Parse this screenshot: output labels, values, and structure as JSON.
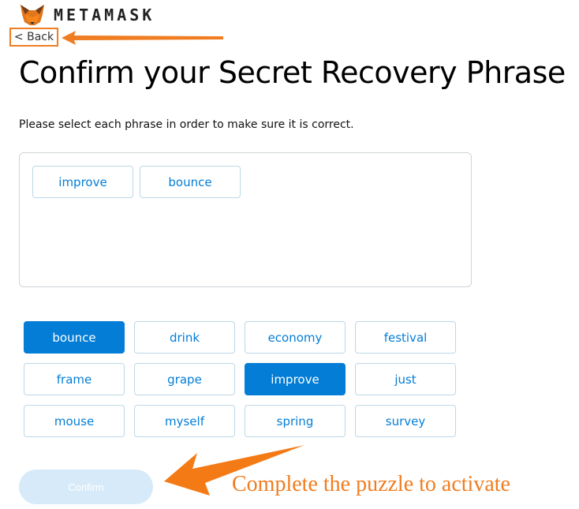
{
  "header": {
    "brand": "METAMASK",
    "back_label": "< Back"
  },
  "page": {
    "title": "Confirm your Secret Recovery Phrase",
    "subtitle": "Please select each phrase in order to make sure it is correct."
  },
  "selected_words": [
    "improve",
    "bounce"
  ],
  "word_bank": [
    {
      "label": "bounce",
      "selected": true
    },
    {
      "label": "drink",
      "selected": false
    },
    {
      "label": "economy",
      "selected": false
    },
    {
      "label": "festival",
      "selected": false
    },
    {
      "label": "frame",
      "selected": false
    },
    {
      "label": "grape",
      "selected": false
    },
    {
      "label": "improve",
      "selected": true
    },
    {
      "label": "just",
      "selected": false
    },
    {
      "label": "mouse",
      "selected": false
    },
    {
      "label": "myself",
      "selected": false
    },
    {
      "label": "spring",
      "selected": false
    },
    {
      "label": "survey",
      "selected": false
    }
  ],
  "confirm_label": "Confirm",
  "annotation": {
    "text": "Complete the puzzle to activate",
    "color": "#f07d21"
  },
  "colors": {
    "accent": "#037dd6",
    "disabled": "#d6eaf9"
  }
}
